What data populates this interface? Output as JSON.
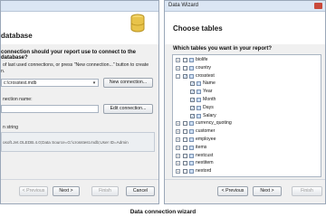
{
  "left": {
    "header_title": "database",
    "question": "connection should your report use to connect to the database?",
    "hint": "of last used connections, or press \"New connection...\" button to create",
    "hint2": "n.",
    "conn_value": "c:\\crosstest.mdb",
    "new_conn_label": "New connection...",
    "name_label": "nection name:",
    "edit_conn_label": "Edit connection...",
    "conn_string_label": "n string",
    "conn_string_value": "osoft.Jet.OLEDB.4.0;Data Source=G:\\crosstest.mdb;User ID=Admin",
    "prev_label": "< Previous",
    "next_label": "Next >",
    "finish_label": "Finish",
    "cancel_label": "Cancel"
  },
  "right": {
    "window_title": "Data Wizard",
    "header_title": "Choose tables",
    "question": "Which tables you want in your report?",
    "tree": [
      {
        "label": "biolife",
        "level": 0,
        "exp": "+",
        "checked": false
      },
      {
        "label": "country",
        "level": 0,
        "exp": "+",
        "checked": false
      },
      {
        "label": "crosstest",
        "level": 0,
        "exp": "-",
        "checked": true
      },
      {
        "label": "Name",
        "level": 1,
        "exp": "",
        "checked": true
      },
      {
        "label": "Year",
        "level": 1,
        "exp": "",
        "checked": true
      },
      {
        "label": "Month",
        "level": 1,
        "exp": "",
        "checked": true
      },
      {
        "label": "Days",
        "level": 1,
        "exp": "",
        "checked": true
      },
      {
        "label": "Salary",
        "level": 1,
        "exp": "",
        "checked": true
      },
      {
        "label": "currency_quoting",
        "level": 0,
        "exp": "+",
        "checked": false
      },
      {
        "label": "customer",
        "level": 0,
        "exp": "+",
        "checked": false
      },
      {
        "label": "employee",
        "level": 0,
        "exp": "+",
        "checked": false
      },
      {
        "label": "items",
        "level": 0,
        "exp": "+",
        "checked": false
      },
      {
        "label": "nextcust",
        "level": 0,
        "exp": "+",
        "checked": false
      },
      {
        "label": "nextitem",
        "level": 0,
        "exp": "+",
        "checked": false
      },
      {
        "label": "nextord",
        "level": 0,
        "exp": "+",
        "checked": false
      }
    ],
    "prev_label": "< Previous",
    "next_label": "Next >",
    "finish_label": "Finish"
  },
  "caption": "Data connection wizard",
  "colors": {
    "accent": "#1d5fb3",
    "db_icon": "#e8c34a"
  }
}
